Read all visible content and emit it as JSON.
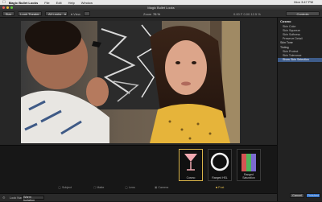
{
  "menubar": {
    "app_name": "Magic Bullet Looks",
    "items": [
      "File",
      "Edit",
      "Help",
      "Window"
    ],
    "status": "Mon 3:47 PM"
  },
  "window": {
    "title": "Magic Bullet Looks"
  },
  "toolbar": {
    "size_label": "Size",
    "look_theater": "Look Theater",
    "looks_dropdown": "All Looks",
    "view_label": "View",
    "zoom_label": "Zoom",
    "zoom_value": "76 %",
    "info_right": "0.00  F  0.00  12.5 %",
    "controls_label": "Controls"
  },
  "inspector": {
    "heading": "Cosmo",
    "items": [
      {
        "label": "Skin Color",
        "kind": "item"
      },
      {
        "label": "Skin Squeeze",
        "kind": "item"
      },
      {
        "label": "Skin Softness",
        "kind": "item"
      },
      {
        "label": "Preserve Detail",
        "kind": "item"
      },
      {
        "label": "Skin Tone",
        "kind": "group"
      },
      {
        "label": "Tinting",
        "kind": "group-sub"
      },
      {
        "label": "Skin Protect",
        "kind": "item"
      },
      {
        "label": "Skin Tolerance",
        "kind": "item"
      },
      {
        "label": "Show Skin Selection",
        "kind": "selected"
      }
    ]
  },
  "tray": {
    "categories": [
      {
        "label": "Subject",
        "icon": "subject-icon"
      },
      {
        "label": "Matte",
        "icon": "matte-icon"
      },
      {
        "label": "Lens",
        "icon": "lens-icon"
      },
      {
        "label": "Camera",
        "icon": "camera-icon"
      }
    ],
    "post_label": "Post",
    "thumbnails": [
      {
        "label": "Cosmo",
        "selected": true
      },
      {
        "label": "Ranged HSL",
        "selected": false
      },
      {
        "label": "Ranged Saturation",
        "selected": false
      }
    ]
  },
  "statusbar": {
    "look_name_label": "Look Name:",
    "look_name_value": "Warm Isolation",
    "cancel": "Cancel",
    "finished": "Finished"
  },
  "colors": {
    "accent_selected": "#3e5c8a",
    "thumb_selected_border": "#d9b44a",
    "finished_button": "#2c6fc9"
  }
}
